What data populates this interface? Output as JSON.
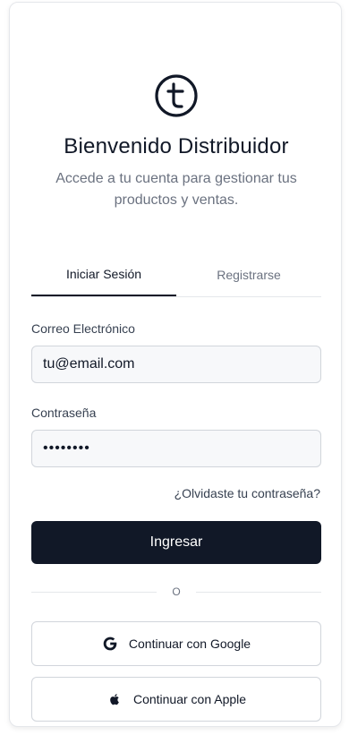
{
  "header": {
    "title": "Bienvenido Distribuidor",
    "subtitle": "Accede a tu cuenta para gestionar tus productos y ventas.",
    "logo_icon": "t-circle-logo"
  },
  "tabs": [
    {
      "label": "Iniciar Sesión",
      "active": true
    },
    {
      "label": "Registrarse",
      "active": false
    }
  ],
  "form": {
    "email_label": "Correo Electrónico",
    "email_value": "tu@email.com",
    "password_label": "Contraseña",
    "password_value": "••••••••",
    "forgot_link": "¿Olvidaste tu contraseña?",
    "submit_label": "Ingresar"
  },
  "divider": {
    "text": "O"
  },
  "social": {
    "google_label": "Continuar con Google",
    "google_icon": "google-icon",
    "apple_label": "Continuar con Apple",
    "apple_icon": "apple-icon"
  },
  "colors": {
    "primary": "#111827",
    "muted": "#6b7280",
    "border": "#e5e7eb",
    "input_bg": "#f7f8fa"
  }
}
